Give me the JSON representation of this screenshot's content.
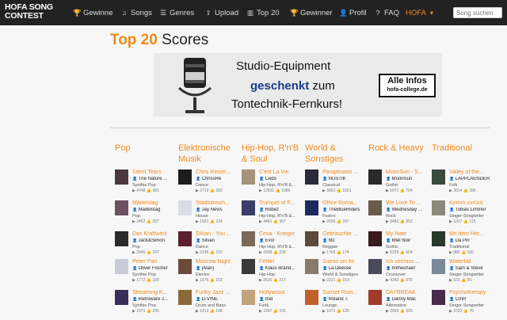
{
  "nav": {
    "logo_line1": "HOFA SONG",
    "logo_line2": "CONTEST",
    "items": [
      {
        "label": "Gewinne",
        "icon": "trophy-icon",
        "glyph": "🏆"
      },
      {
        "label": "Songs",
        "icon": "music-icon",
        "glyph": "♫"
      },
      {
        "label": "Genres",
        "icon": "list-icon",
        "glyph": "☰"
      },
      {
        "label": "Upload",
        "icon": "upload-icon",
        "glyph": "⇪"
      },
      {
        "label": "Top 20",
        "icon": "chart-icon",
        "glyph": "▥"
      },
      {
        "label": "Gewinner",
        "icon": "trophy-icon",
        "glyph": "🏆"
      },
      {
        "label": "Profil",
        "icon": "user-icon",
        "glyph": "👤"
      },
      {
        "label": "FAQ",
        "icon": "question-icon",
        "glyph": "?"
      },
      {
        "label": "HOFA",
        "icon": "caret-down-icon",
        "glyph": "▾"
      }
    ],
    "search_placeholder": "Song suchen"
  },
  "heading": {
    "accent": "Top 20",
    "rest": "Scores"
  },
  "banner": {
    "line1": "Studio-Equipment",
    "line2_bold": "geschenkt",
    "line2_rest": "zum",
    "line3": "Tontechnik-Fernkurs!",
    "box_title": "Alle Infos",
    "box_url": "hofa-college.de"
  },
  "accent_color": "#f08a1e",
  "columns": [
    {
      "heading": "Pop",
      "entries": [
        {
          "title": "Silent Tears",
          "artist": "The Nature ...",
          "genre": "Synthie Pop",
          "plays": "4748",
          "likes": "491",
          "thumb": "#4a3a3e"
        },
        {
          "title": "Mädelstag",
          "artist": "Mädelstag",
          "genre": "Pop",
          "plays": "2452",
          "likes": "297",
          "thumb": "#6e5060"
        },
        {
          "title": "Das Kraftwerk",
          "artist": "Jack&Simon",
          "genre": "Pop",
          "plays": "2940",
          "likes": "247",
          "thumb": "#2b2b2b"
        },
        {
          "title": "Peter Pan",
          "artist": "Oliver Fischer",
          "genre": "Synthie Pop",
          "plays": "1772",
          "likes": "228",
          "thumb": "#c9ccd6"
        },
        {
          "title": "Streaming K...",
          "artist": "Retroware 2...",
          "genre": "Synthie Pop",
          "plays": "1971",
          "likes": "200",
          "thumb": "#3a2e5a"
        }
      ]
    },
    {
      "heading": "Elektronische Musik",
      "entries": [
        {
          "title": "Chris Reiser...",
          "artist": "ChrissRe",
          "genre": "Dance",
          "plays": "2719",
          "likes": "392",
          "thumb": "#1c1c1c"
        },
        {
          "title": "Stadtstreich...",
          "artist": "Jay Nevis",
          "genre": "House",
          "plays": "1931",
          "likes": "224",
          "thumb": "#d9dde6"
        },
        {
          "title": "Silvan - You ...",
          "artist": "Silvan",
          "genre": "Dance",
          "plays": "2145",
          "likes": "210",
          "thumb": "#5a2030"
        },
        {
          "title": "Moscow Night",
          "artist": "[Alan]",
          "genre": "Electro",
          "plays": "1676",
          "likes": "153",
          "thumb": "#6b4a3a"
        },
        {
          "title": "Funky Jazz ...",
          "artist": "D-VINE",
          "genre": "Drum and Bass",
          "plays": "1412",
          "likes": "148",
          "thumb": "#8a6a3a"
        }
      ]
    },
    {
      "heading": "Hip-Hop, R'n'B & Soul",
      "entries": [
        {
          "title": "C'est La Vie",
          "artist": "Cedo",
          "genre": "Hip-Hop, R'n'B &...",
          "plays": "12531",
          "likes": "1089",
          "thumb": "#a4927a"
        },
        {
          "title": "Trumpet of F...",
          "artist": "Robez",
          "genre": "Hip-Hop, R'n'B &...",
          "plays": "4481",
          "likes": "367",
          "thumb": "#3a3f6a"
        },
        {
          "title": "Cesa - Krieger",
          "artist": "Evo!",
          "genre": "Hip-Hop, R'n'B &...",
          "plays": "2908",
          "likes": "228",
          "thumb": "#7a6a5a"
        },
        {
          "title": "Fehler",
          "artist": "Klaus Brand...",
          "genre": "Hip-Hop",
          "plays": "2626",
          "likes": "217",
          "thumb": "#3a3a3a"
        },
        {
          "title": "Hollywood",
          "artist": "mid",
          "genre": "Funk",
          "plays": "1997",
          "likes": "155",
          "thumb": "#c2a27a"
        }
      ]
    },
    {
      "heading": "World & Sonstiges",
      "entries": [
        {
          "title": "Paraphrasis ...",
          "artist": "NUSTIK",
          "genre": "Classical",
          "plays": "9953",
          "likes": "1021",
          "thumb": "#2a2a3a"
        },
        {
          "title": "Office Roma...",
          "artist": "TheBlueRiders",
          "genre": "Fusion",
          "plays": "2035",
          "likes": "247",
          "thumb": "#1a2a5a"
        },
        {
          "title": "Gebrauchte ...",
          "artist": "htc",
          "genre": "Reggae",
          "plays": "1765",
          "likes": "174",
          "thumb": "#5a4a3a"
        },
        {
          "title": "Sueno sin fin",
          "artist": "La Déesse",
          "genre": "World & Sonstiges",
          "plays": "2221",
          "likes": "153",
          "thumb": "#8a7a6a"
        },
        {
          "title": "Sunset Rom...",
          "artist": "Roland T.",
          "genre": "Lounge",
          "plays": "1071",
          "likes": "120",
          "thumb": "#c0602a"
        }
      ]
    },
    {
      "heading": "Rock & Heavy",
      "entries": [
        {
          "title": "MoonSun - S...",
          "artist": "MoonSun",
          "genre": "Gothic",
          "plays": "5971",
          "likes": "704",
          "thumb": "#2a2a2a"
        },
        {
          "title": "We Love To ...",
          "artist": "Wednesday ...",
          "genre": "Rock",
          "plays": "6482",
          "likes": "652",
          "thumb": "#6a5a4a"
        },
        {
          "title": "My Hate",
          "artist": "Miel Noir",
          "genre": "Gothic",
          "plays": "5239",
          "likes": "604",
          "thumb": "#3a1a1a"
        },
        {
          "title": "Ich vermiss ...",
          "artist": "finthechaef",
          "genre": "Crossover",
          "plays": "4343",
          "likes": "376",
          "thumb": "#4a4a5a"
        },
        {
          "title": "DAYBREAK",
          "artist": "Danny Mac",
          "genre": "Alternative",
          "plays": "2659",
          "likes": "329",
          "thumb": "#a03a2a"
        }
      ]
    },
    {
      "heading": "Traditional",
      "entries": [
        {
          "title": "Valley of the...",
          "artist": "LAPPLAENDER",
          "genre": "Folk",
          "plays": "3014",
          "likes": "396",
          "thumb": "#3a4a3a"
        },
        {
          "title": "Komm zurück",
          "artist": "Tobias Limmer",
          "genre": "Singer-Songwriter",
          "plays": "1017",
          "likes": "115",
          "thumb": "#8a8a7a"
        },
        {
          "title": "Mit dem Her...",
          "artist": "Da Piri",
          "genre": "Traditional",
          "plays": "882",
          "likes": "100",
          "thumb": "#2a3a2a"
        },
        {
          "title": "Waterfall",
          "artist": "Sam & Steve",
          "genre": "Singer-Songwriter",
          "plays": "633",
          "likes": "95",
          "thumb": "#7a8a9a"
        },
        {
          "title": "Psychotherapy",
          "artist": "CmR",
          "genre": "Singer-Songwriter",
          "plays": "1033",
          "likes": "70",
          "thumb": "#4a2a4a"
        }
      ]
    }
  ]
}
